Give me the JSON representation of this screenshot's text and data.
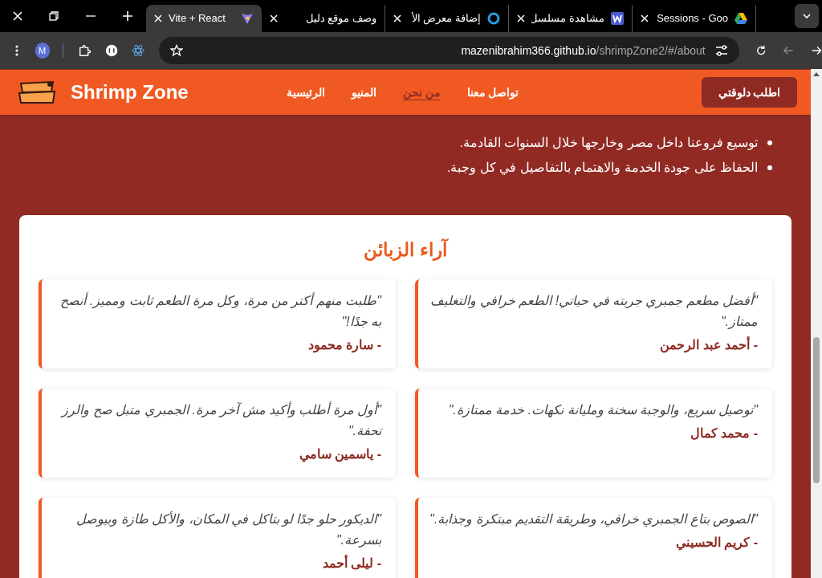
{
  "browser": {
    "tabs": [
      {
        "title": "Sessions - Goo",
        "selected": false,
        "kind": "drive"
      },
      {
        "title": "مشاهدة مسلسل",
        "selected": false,
        "kind": "w"
      },
      {
        "title": "إضافة معرض الأ",
        "selected": false,
        "kind": "circle"
      },
      {
        "title": "وصف موقع دليل",
        "selected": false,
        "kind": "none"
      },
      {
        "title": "Vite + React",
        "selected": true,
        "kind": "vite"
      }
    ],
    "profile_initial": "M",
    "address": {
      "host": "mazenibrahim366.github.io",
      "path": "/shrimpZone2/#/about"
    }
  },
  "header": {
    "brand": "Shrimp Zone",
    "nav": [
      {
        "label": "تواصل معنا",
        "selected": false
      },
      {
        "label": "من نحن",
        "selected": true
      },
      {
        "label": "المنيو",
        "selected": false
      },
      {
        "label": "الرئيسية",
        "selected": false
      }
    ],
    "cta": "اطلب دلوقتي"
  },
  "goals": [
    "توسيع فروعنا داخل مصر وخارجها خلال السنوات القادمة.",
    "الحفاظ على جودة الخدمة والاهتمام بالتفاصيل في كل وجبة."
  ],
  "testimonials": {
    "title": "آراء الزبائن",
    "items": [
      {
        "quote": "\"أفضل مطعم جمبري جربته في حياتي! الطعم خرافي والتغليف ممتاز.\"",
        "author": "- أحمد عبد الرحمن"
      },
      {
        "quote": "\"طلبت منهم أكتر من مرة، وكل مرة الطعم ثابت ومميز. أنصح به جدًا!\"",
        "author": "- سارة محمود"
      },
      {
        "quote": "\"توصيل سريع، والوجبة سخنة ومليانة نكهات. خدمة ممتازة.\"",
        "author": "- محمد كمال"
      },
      {
        "quote": "\"أول مرة أطلب وأكيد مش آخر مرة. الجمبري متبل صح والرز تحفة.\"",
        "author": "- ياسمين سامي"
      },
      {
        "quote": "\"الصوص بتاع الجمبري خرافي، وطريقة التقديم مبتكرة وجذابة.\"",
        "author": "- كريم الحسيني"
      },
      {
        "quote": "\"الديكور حلو جدًا لو بتاكل في المكان، والأكل طازة وبيوصل بسرعة.\"",
        "author": "- ليلى أحمد"
      }
    ]
  }
}
